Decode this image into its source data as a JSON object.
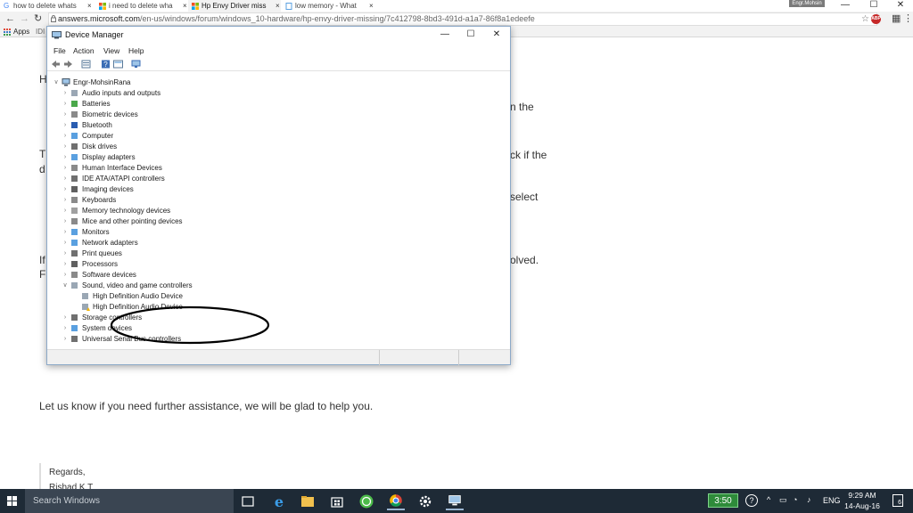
{
  "browser": {
    "tabs": [
      {
        "title": "how to delete whats",
        "icon": "google-icon",
        "active": false
      },
      {
        "title": "i need to delete wha",
        "icon": "microsoft-icon",
        "active": false
      },
      {
        "title": "Hp Envy Driver miss",
        "icon": "microsoft-icon",
        "active": true
      },
      {
        "title": "low memory - What",
        "icon": "page-icon",
        "active": false
      }
    ],
    "tab_close": "×",
    "user_badge": "Engr.Mohsin",
    "address": {
      "host": "answers.microsoft.com",
      "path": "/en-us/windows/forum/windows_10-hardware/hp-envy-driver-missing/7c412798-8bd3-491d-a1a7-86f8a1edeefe"
    },
    "bookmarks": {
      "apps_label": "Apps",
      "item2": "IDI c"
    },
    "abp_label": "ABP",
    "controls": {
      "min": "—",
      "max": "☐",
      "close": "✕"
    }
  },
  "page": {
    "frag_h": "H",
    "frag_the": "n the",
    "frag_t": "T",
    "frag_ck": "ck if the",
    "frag_d": "d",
    "frag_select": "select",
    "frag_if": "If",
    "frag_olved": "olved.",
    "frag_f": "F",
    "closing": "Let us know if you need further assistance, we will be glad to help you.",
    "regards": "Regards,",
    "signature": "Rishad K T"
  },
  "device_manager": {
    "title": "Device Manager",
    "menu": [
      "File",
      "Action",
      "View",
      "Help"
    ],
    "root": "Engr-MohsinRana",
    "categories": [
      {
        "label": "Audio inputs and outputs",
        "icon": "speaker-icon",
        "expanded": false
      },
      {
        "label": "Batteries",
        "icon": "battery-icon",
        "expanded": false
      },
      {
        "label": "Biometric devices",
        "icon": "biometric-icon",
        "expanded": false
      },
      {
        "label": "Bluetooth",
        "icon": "bluetooth-icon",
        "expanded": false
      },
      {
        "label": "Computer",
        "icon": "computer-icon",
        "expanded": false
      },
      {
        "label": "Disk drives",
        "icon": "disk-icon",
        "expanded": false
      },
      {
        "label": "Display adapters",
        "icon": "display-adapter-icon",
        "expanded": false
      },
      {
        "label": "Human Interface Devices",
        "icon": "hid-icon",
        "expanded": false
      },
      {
        "label": "IDE ATA/ATAPI controllers",
        "icon": "ide-icon",
        "expanded": false
      },
      {
        "label": "Imaging devices",
        "icon": "camera-icon",
        "expanded": false
      },
      {
        "label": "Keyboards",
        "icon": "keyboard-icon",
        "expanded": false
      },
      {
        "label": "Memory technology devices",
        "icon": "memory-icon",
        "expanded": false
      },
      {
        "label": "Mice and other pointing devices",
        "icon": "mouse-icon",
        "expanded": false
      },
      {
        "label": "Monitors",
        "icon": "monitor-icon",
        "expanded": false
      },
      {
        "label": "Network adapters",
        "icon": "network-icon",
        "expanded": false
      },
      {
        "label": "Print queues",
        "icon": "printer-icon",
        "expanded": false
      },
      {
        "label": "Processors",
        "icon": "processor-icon",
        "expanded": false
      },
      {
        "label": "Software devices",
        "icon": "software-icon",
        "expanded": false
      },
      {
        "label": "Sound, video and game controllers",
        "icon": "speaker-icon",
        "expanded": true,
        "children": [
          {
            "label": "High Definition Audio Device",
            "icon": "speaker-icon",
            "warning": false
          },
          {
            "label": "High Definition Audio Device",
            "icon": "speaker-warning-icon",
            "warning": true
          }
        ]
      },
      {
        "label": "Storage controllers",
        "icon": "storage-icon",
        "expanded": false
      },
      {
        "label": "System devices",
        "icon": "system-icon",
        "expanded": false
      },
      {
        "label": "Universal Serial Bus controllers",
        "icon": "usb-icon",
        "expanded": false
      }
    ]
  },
  "taskbar": {
    "search_placeholder": "Search Windows",
    "apps": [
      "task-view-icon",
      "edge-icon",
      "file-explorer-icon",
      "store-icon",
      "whatsapp-icon",
      "chrome-icon",
      "settings-icon",
      "device-manager-icon"
    ],
    "badge": "3:50",
    "help": "?",
    "tray": [
      "^",
      "▭",
      "◔",
      "♪"
    ],
    "lang": "ENG",
    "time": "9:29 AM",
    "date": "14-Aug-16",
    "notifications": "6"
  },
  "colors": {
    "taskbar": "#1e2a36",
    "accent": "#3b78c4",
    "warning": "#f2b400",
    "badge": "#2e8b3a"
  }
}
